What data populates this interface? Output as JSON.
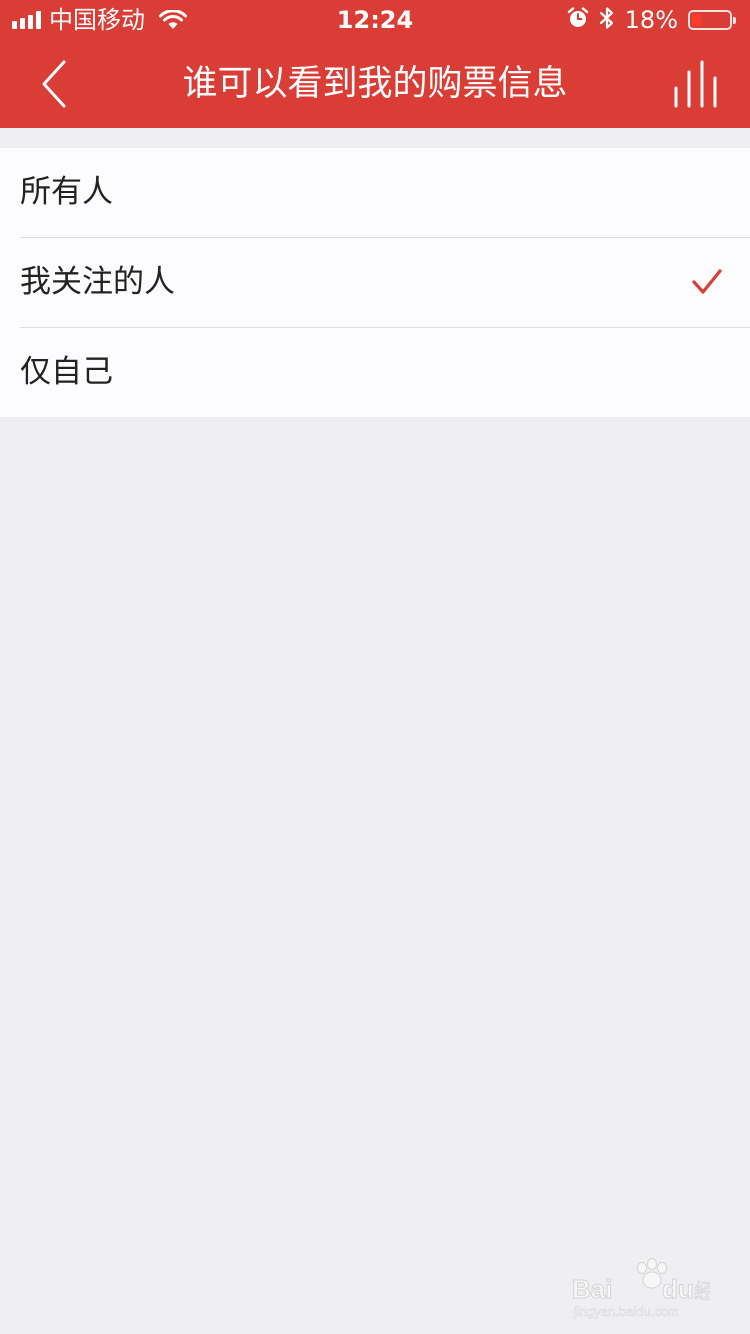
{
  "status_bar": {
    "carrier": "中国移动",
    "time": "12:24",
    "battery_percent": "18%",
    "battery_level": 0.18,
    "icons": [
      "signal-icon",
      "wifi-icon",
      "alarm-icon",
      "bluetooth-icon",
      "battery-icon"
    ]
  },
  "nav": {
    "title": "谁可以看到我的购票信息",
    "back_icon": "chevron-left-icon",
    "right_icon": "bar-chart-icon"
  },
  "options": [
    {
      "label": "所有人",
      "selected": false
    },
    {
      "label": "我关注的人",
      "selected": true
    },
    {
      "label": "仅自己",
      "selected": false
    }
  ],
  "watermark": {
    "brand": "Bai",
    "brand2": "du",
    "suffix": "经验",
    "url": "jingyan.baidu.com"
  },
  "colors": {
    "header": "#d93d35",
    "accent_check": "#d93d35",
    "background": "#efeff1",
    "list_background": "#fcfcfe"
  }
}
